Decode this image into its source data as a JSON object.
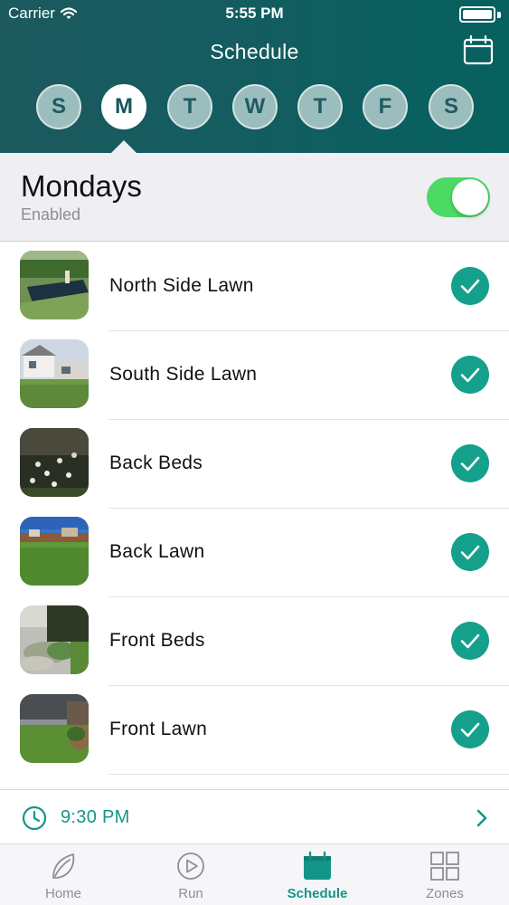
{
  "status_bar": {
    "carrier": "Carrier",
    "time": "5:55 PM",
    "icons": [
      "wifi-icon",
      "battery-icon"
    ]
  },
  "nav": {
    "title": "Schedule",
    "calendar_icon": "calendar-icon"
  },
  "days": [
    {
      "label": "S",
      "active": false
    },
    {
      "label": "M",
      "active": true
    },
    {
      "label": "T",
      "active": false
    },
    {
      "label": "W",
      "active": false
    },
    {
      "label": "T",
      "active": false
    },
    {
      "label": "F",
      "active": false
    },
    {
      "label": "S",
      "active": false
    }
  ],
  "day_section": {
    "title": "Mondays",
    "status": "Enabled",
    "toggle_on": true
  },
  "zones": [
    {
      "name": "North Side Lawn",
      "checked": true,
      "thumb": "pool-lawn"
    },
    {
      "name": "South Side Lawn",
      "checked": true,
      "thumb": "house-lawn"
    },
    {
      "name": "Back Beds",
      "checked": true,
      "thumb": "flower-bed"
    },
    {
      "name": "Back Lawn",
      "checked": true,
      "thumb": "fenced-lawn"
    },
    {
      "name": "Front Beds",
      "checked": true,
      "thumb": "rock-bed"
    },
    {
      "name": "Front Lawn",
      "checked": true,
      "thumb": "front-yard"
    }
  ],
  "time_row": {
    "time": "9:30 PM",
    "icon": "clock-icon"
  },
  "tabs": [
    {
      "label": "Home",
      "icon": "leaf-icon",
      "active": false
    },
    {
      "label": "Run",
      "icon": "play-icon",
      "active": false
    },
    {
      "label": "Schedule",
      "icon": "calendar-icon",
      "active": true
    },
    {
      "label": "Zones",
      "icon": "grid-icon",
      "active": false
    }
  ],
  "colors": {
    "header": "#145c60",
    "accent": "#14958a",
    "check": "#15a08b",
    "toggle_on": "#4cd964",
    "section_bg": "#efeef3"
  }
}
